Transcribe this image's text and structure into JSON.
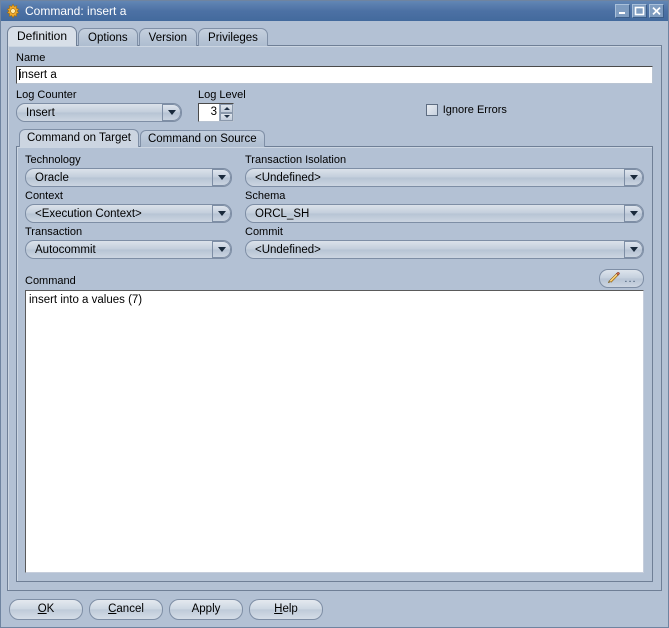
{
  "window": {
    "title": "Command: insert a",
    "icon": "gear-sun-icon",
    "controls": {
      "minimize": "minimize-icon",
      "maximize": "maximize-icon",
      "close": "close-icon"
    }
  },
  "tabs": [
    {
      "label": "Definition",
      "selected": true
    },
    {
      "label": "Options",
      "selected": false
    },
    {
      "label": "Version",
      "selected": false
    },
    {
      "label": "Privileges",
      "selected": false
    }
  ],
  "definition": {
    "name": {
      "label": "Name",
      "value": "insert a"
    },
    "log_counter": {
      "label": "Log Counter",
      "value": "Insert"
    },
    "log_level": {
      "label": "Log Level",
      "value": "3"
    },
    "ignore_errors": {
      "label": "Ignore Errors",
      "checked": false
    },
    "inner_tabs": [
      {
        "label": "Command on Target",
        "selected": true
      },
      {
        "label": "Command on Source",
        "selected": false
      }
    ],
    "fields": {
      "technology": {
        "label": "Technology",
        "value": "Oracle"
      },
      "transaction_isolation": {
        "label": "Transaction Isolation",
        "value": "<Undefined>"
      },
      "context": {
        "label": "Context",
        "value": "<Execution Context>"
      },
      "schema": {
        "label": "Schema",
        "value": "ORCL_SH"
      },
      "transaction": {
        "label": "Transaction",
        "value": "Autocommit"
      },
      "commit": {
        "label": "Commit",
        "value": "<Undefined>"
      }
    },
    "command": {
      "label": "Command",
      "value": "insert into a values (7)",
      "edit_button": {
        "icon": "pencil-icon",
        "ellipsis": "..."
      }
    }
  },
  "footer": {
    "ok": {
      "pre": "",
      "mnemonic": "O",
      "post": "K"
    },
    "cancel": {
      "pre": "",
      "mnemonic": "C",
      "post": "ancel"
    },
    "apply": {
      "label": "Apply"
    },
    "help": {
      "pre": "",
      "mnemonic": "H",
      "post": "elp"
    }
  },
  "colors": {
    "titlebar": "#4c71a4",
    "background": "#b3c1d4",
    "panel_border": "#6f7f96",
    "field_bg": "#ffffff",
    "accent_icon": "#f0a92c"
  }
}
